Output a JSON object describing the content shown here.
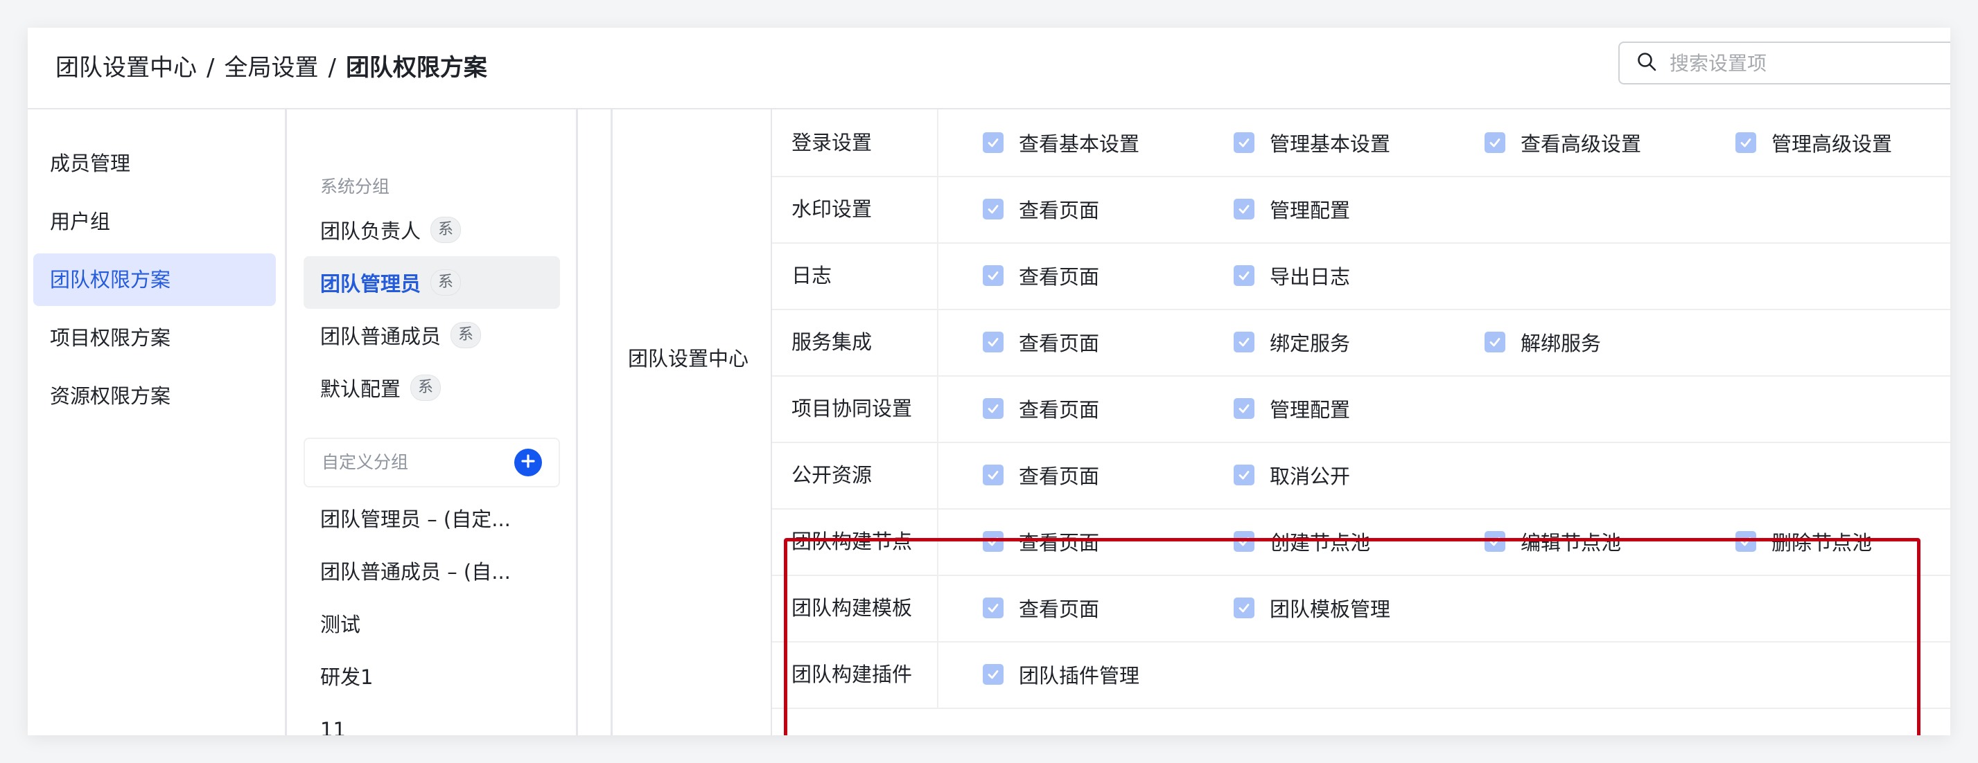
{
  "breadcrumb": {
    "level1": "团队设置中心",
    "sep": "/",
    "level2": "全局设置",
    "current": "团队权限方案"
  },
  "search": {
    "placeholder": "搜索设置项",
    "value": ""
  },
  "nav": {
    "items": [
      {
        "label": "成员管理",
        "active": false
      },
      {
        "label": "用户组",
        "active": false
      },
      {
        "label": "团队权限方案",
        "active": true
      },
      {
        "label": "项目权限方案",
        "active": false
      },
      {
        "label": "资源权限方案",
        "active": false
      }
    ]
  },
  "roles": {
    "system_group_title": "系统分组",
    "system_tag": "系",
    "system_items": [
      {
        "label": "团队负责人",
        "active": false
      },
      {
        "label": "团队管理员",
        "active": true
      },
      {
        "label": "团队普通成员",
        "active": false
      },
      {
        "label": "默认配置",
        "active": false
      }
    ],
    "custom_group_title": "自定义分组",
    "custom_items": [
      "团队管理员 – (自定...",
      "团队普通成员 – (自...",
      "测试",
      "研发1",
      "11"
    ]
  },
  "module": {
    "name": "团队设置中心"
  },
  "permissions": {
    "rows": [
      {
        "name": "登录设置",
        "perms": [
          "查看基本设置",
          "管理基本设置",
          "查看高级设置",
          "管理高级设置"
        ]
      },
      {
        "name": "水印设置",
        "perms": [
          "查看页面",
          "管理配置"
        ]
      },
      {
        "name": "日志",
        "perms": [
          "查看页面",
          "导出日志"
        ]
      },
      {
        "name": "服务集成",
        "perms": [
          "查看页面",
          "绑定服务",
          "解绑服务"
        ]
      },
      {
        "name": "项目协同设置",
        "perms": [
          "查看页面",
          "管理配置"
        ]
      },
      {
        "name": "公开资源",
        "perms": [
          "查看页面",
          "取消公开"
        ]
      },
      {
        "name": "团队构建节点",
        "perms": [
          "查看页面",
          "创建节点池",
          "编辑节点池",
          "删除节点池"
        ]
      },
      {
        "name": "团队构建模板",
        "perms": [
          "查看页面",
          "团队模板管理"
        ]
      },
      {
        "name": "团队构建插件",
        "perms": [
          "团队插件管理"
        ]
      }
    ]
  },
  "colors": {
    "accent": "#245bdb",
    "active_nav_bg": "#e1e7fe",
    "checkbox": "#a9c2f7",
    "add_button": "#1456f0",
    "highlight_border": "#c30012"
  },
  "icons": {
    "search": "search-icon",
    "add": "plus-icon",
    "checkbox": "checkmark-icon"
  }
}
